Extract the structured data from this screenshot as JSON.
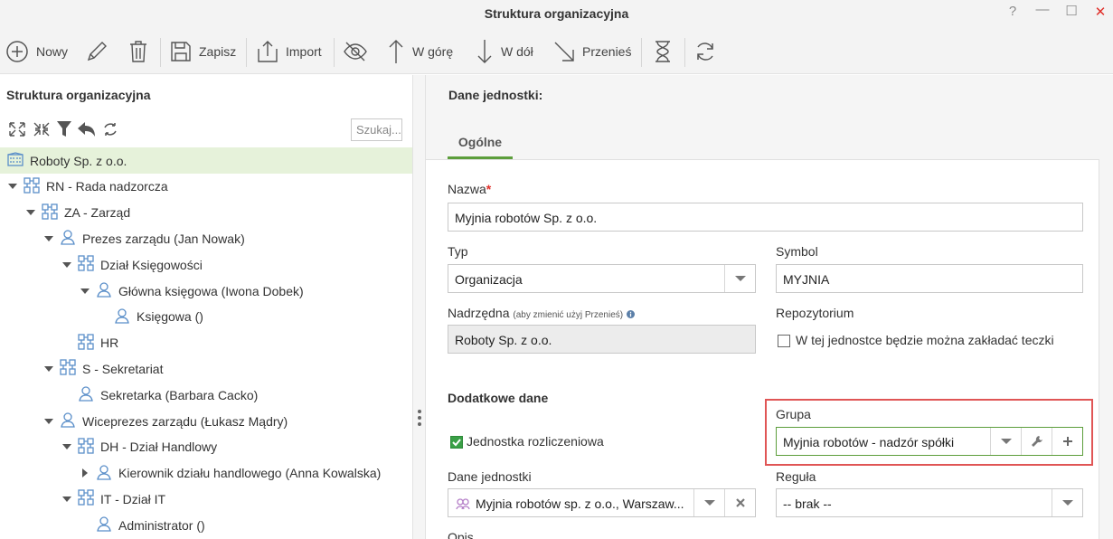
{
  "window": {
    "title": "Struktura organizacyjna",
    "help": "?",
    "minimize": "—",
    "maximize": "☐",
    "close": "✕"
  },
  "toolbar": {
    "new_label": "Nowy",
    "save_label": "Zapisz",
    "import_label": "Import",
    "up_label": "W górę",
    "down_label": "W dół",
    "move_label": "Przenieś"
  },
  "left": {
    "title": "Struktura organizacyjna",
    "search_placeholder": "Szukaj..."
  },
  "tree": [
    {
      "label": "Roboty Sp. z o.o.",
      "icon": "building-icon",
      "level": 0,
      "expand": "none",
      "selected": true
    },
    {
      "label": "RN - Rada nadzorcza",
      "icon": "org-unit-icon",
      "level": 0,
      "expand": "open"
    },
    {
      "label": "ZA - Zarząd",
      "icon": "org-unit-icon",
      "level": 1,
      "expand": "open"
    },
    {
      "label": "Prezes zarządu (Jan Nowak)",
      "icon": "person-icon",
      "level": 2,
      "expand": "open"
    },
    {
      "label": "Dział Księgowości",
      "icon": "org-unit-icon",
      "level": 3,
      "expand": "open"
    },
    {
      "label": "Główna księgowa (Iwona Dobek)",
      "icon": "person-icon",
      "level": 4,
      "expand": "open"
    },
    {
      "label": "Księgowa ()",
      "icon": "person-icon",
      "level": 5,
      "expand": "none"
    },
    {
      "label": "HR",
      "icon": "org-unit-icon",
      "level": 3,
      "expand": "none"
    },
    {
      "label": "S - Sekretariat",
      "icon": "org-unit-icon",
      "level": 2,
      "expand": "open"
    },
    {
      "label": "Sekretarka (Barbara Cacko)",
      "icon": "person-icon",
      "level": 3,
      "expand": "none"
    },
    {
      "label": "Wiceprezes zarządu (Łukasz Mądry)",
      "icon": "person-icon",
      "level": 2,
      "expand": "open"
    },
    {
      "label": "DH - Dział Handlowy",
      "icon": "org-unit-icon",
      "level": 3,
      "expand": "open"
    },
    {
      "label": "Kierownik działu handlowego (Anna Kowalska)",
      "icon": "person-icon",
      "level": 4,
      "expand": "closed"
    },
    {
      "label": "IT - Dział IT",
      "icon": "org-unit-icon",
      "level": 3,
      "expand": "open"
    },
    {
      "label": "Administrator ()",
      "icon": "person-icon",
      "level": 4,
      "expand": "none"
    }
  ],
  "right": {
    "title": "Dane jednostki:",
    "tab_general": "Ogólne",
    "name_label": "Nazwa",
    "name_required": "*",
    "name_value": "Myjnia robotów Sp. z o.o.",
    "type_label": "Typ",
    "type_value": "Organizacja",
    "symbol_label": "Symbol",
    "symbol_value": "MYJNIA",
    "parent_label": "Nadrzędna",
    "parent_hint": "(aby zmienić użyj Przenieś)",
    "parent_value": "Roboty Sp. z o.o.",
    "repo_label": "Repozytorium",
    "repo_checkbox": "W tej jednostce będzie można zakładać teczki",
    "extra_section": "Dodatkowe dane",
    "billing_checkbox": "Jednostka rozliczeniowa",
    "group_label": "Grupa",
    "group_value": "Myjnia robotów - nadzór spółki",
    "unit_data_label": "Dane jednostki",
    "unit_data_value": "Myjnia robotów sp. z o.o., Warszaw...",
    "rule_label": "Reguła",
    "rule_value": "-- brak --",
    "desc_label": "Opis"
  },
  "colors": {
    "accent": "#5c9e3b",
    "selected_row": "#e6f2da",
    "highlight": "#e05555",
    "icon_blue": "#5b8fc9"
  }
}
